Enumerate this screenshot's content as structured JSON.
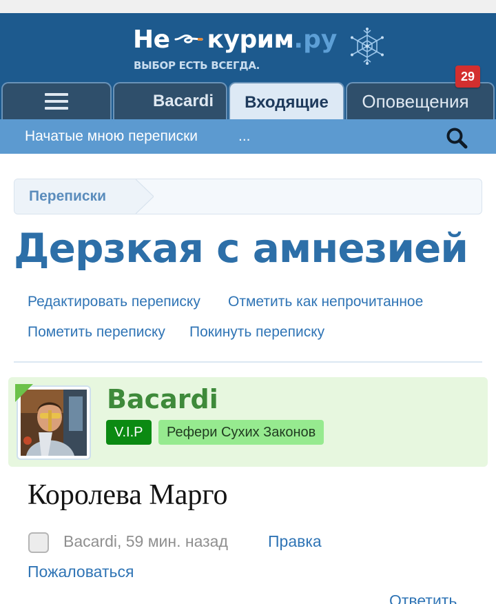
{
  "site": {
    "logo_ne": "Не",
    "logo_kurim": "курим",
    "logo_dot": ".",
    "logo_ru": "ру",
    "tagline": "ВЫБОР ЕСТЬ ВСЕГДА."
  },
  "tabs": [
    {
      "label": "",
      "icon": "hamburger-menu-icon"
    },
    {
      "label": "Bacardi"
    },
    {
      "label": "Входящие",
      "active": true
    },
    {
      "label": "Оповещения",
      "badge": "29"
    }
  ],
  "subnav": {
    "started_by_me": "Начатые мною переписки",
    "more": "...",
    "search_icon": "search-icon"
  },
  "breadcrumb": {
    "items": [
      "Переписки"
    ]
  },
  "conversation": {
    "title": "Дерзкая с амнезией",
    "actions": {
      "edit": "Редактировать переписку",
      "mark_unread": "Отметить как непрочитанное",
      "flag": "Пометить переписку",
      "leave": "Покинуть переписку"
    }
  },
  "message": {
    "author": "Bacardi",
    "banners": [
      "V.I.P",
      "Рефери Сухих Законов"
    ],
    "text": "Королева Марго",
    "meta": "Bacardi, 59 мин. назад",
    "edit": "Правка",
    "report": "Пожаловаться",
    "reply": "Ответить"
  },
  "colors": {
    "header_bg": "#1d5a8e",
    "subnav_bg": "#5c9ad0",
    "title_blue": "#2d6fa8",
    "link_blue": "#2f74b5",
    "user_block_bg": "#e7f7df",
    "username_green": "#3e8a3a",
    "vip_green": "#0b8a12",
    "role_green": "#96ea8f",
    "badge_red": "#d32f2f"
  }
}
